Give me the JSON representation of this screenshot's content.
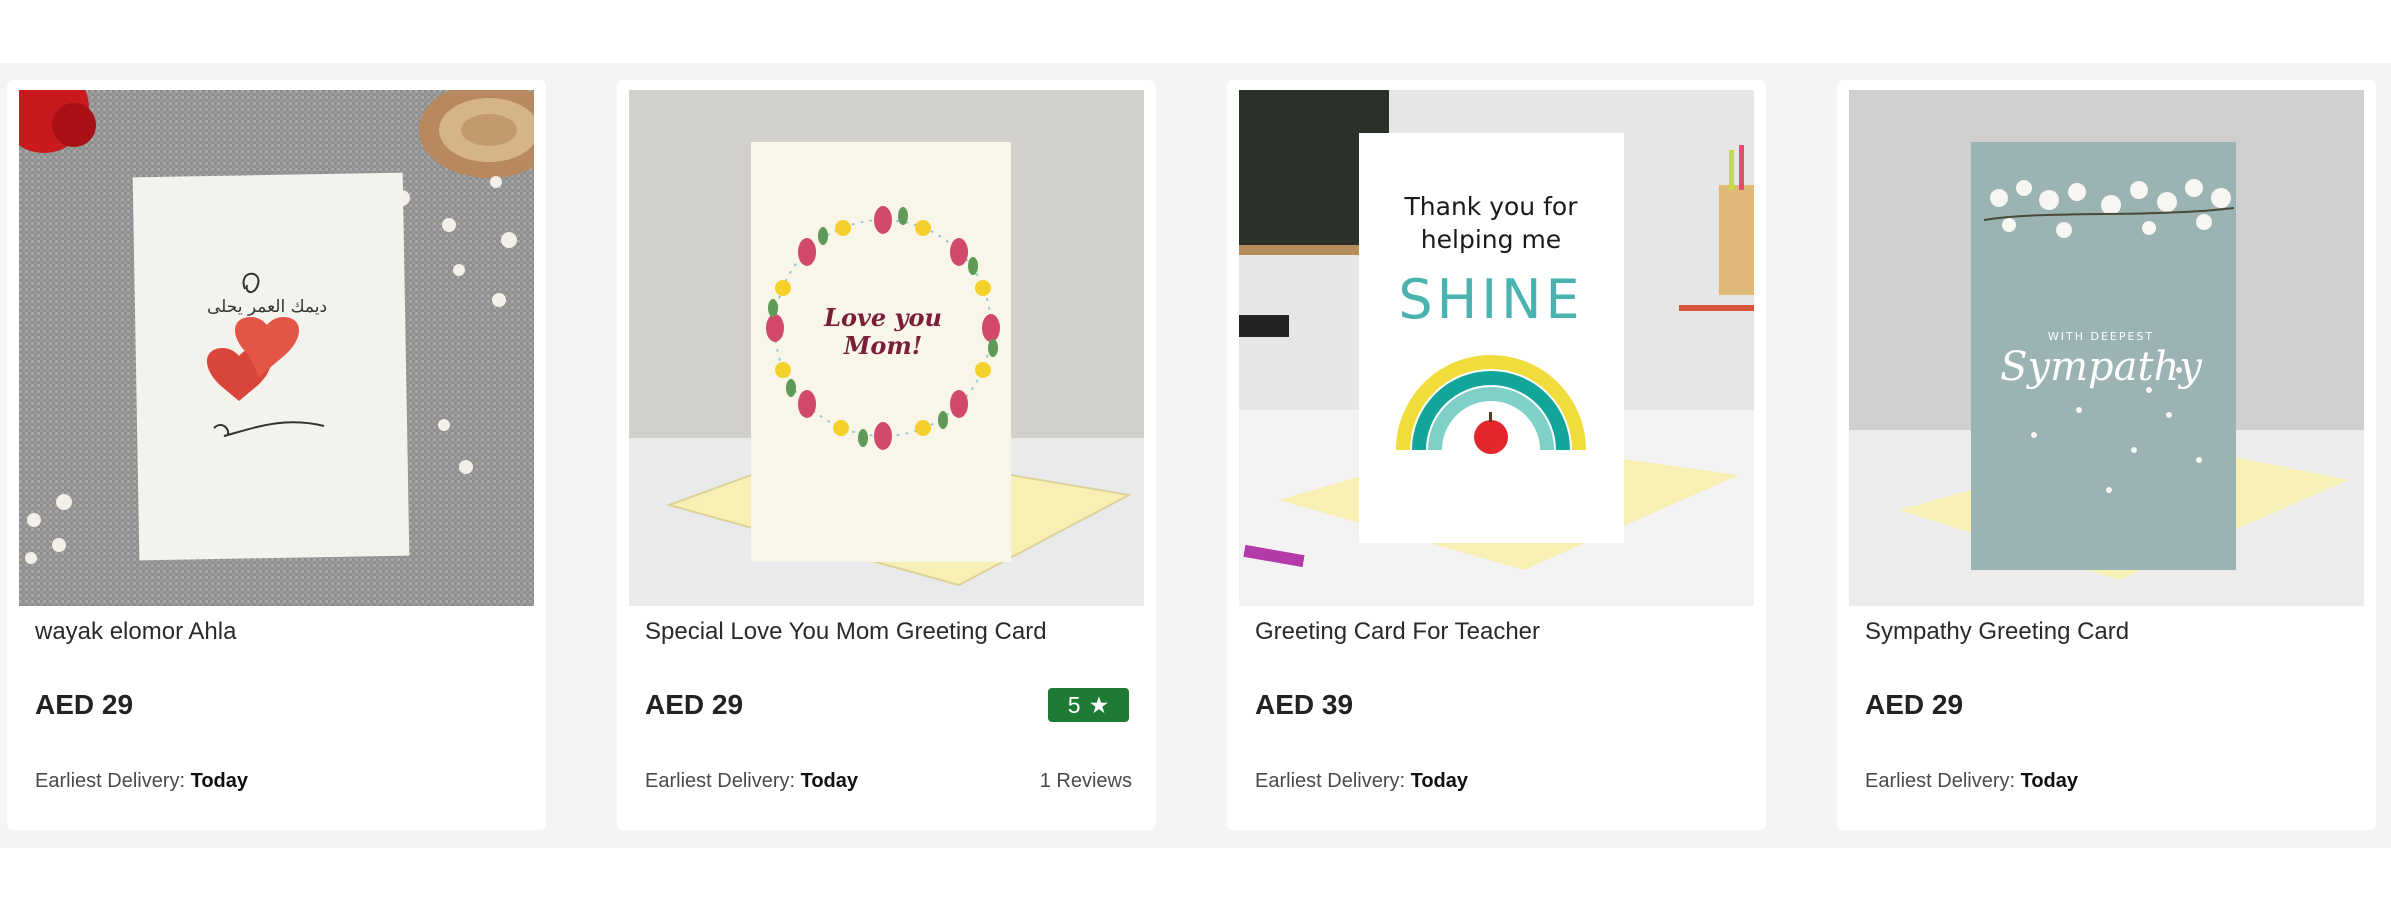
{
  "products": [
    {
      "name": "wayak elomor Ahla",
      "price": "AED 29",
      "delivery_label": "Earliest Delivery:",
      "delivery_value": "Today",
      "image_text": "ديمك العمر يحلى"
    },
    {
      "name": "Special Love You Mom Greeting Card",
      "price": "AED 29",
      "delivery_label": "Earliest Delivery:",
      "delivery_value": "Today",
      "rating": "5",
      "reviews": "1 Reviews",
      "image_text_1": "Love you",
      "image_text_2": "Mom!"
    },
    {
      "name": "Greeting Card For Teacher",
      "price": "AED 39",
      "delivery_label": "Earliest Delivery:",
      "delivery_value": "Today",
      "image_text_1": "Thank you for",
      "image_text_2": "helping me",
      "image_text_3": "SHINE"
    },
    {
      "name": "Sympathy Greeting Card",
      "price": "AED 29",
      "delivery_label": "Earliest Delivery:",
      "delivery_value": "Today",
      "image_text_1": "WITH DEEPEST",
      "image_text_2": "Sympathy"
    }
  ],
  "colors": {
    "rating_badge": "#1f7a34",
    "band_background": "#f4f4f4"
  },
  "icons": {
    "rating": "star-icon"
  }
}
